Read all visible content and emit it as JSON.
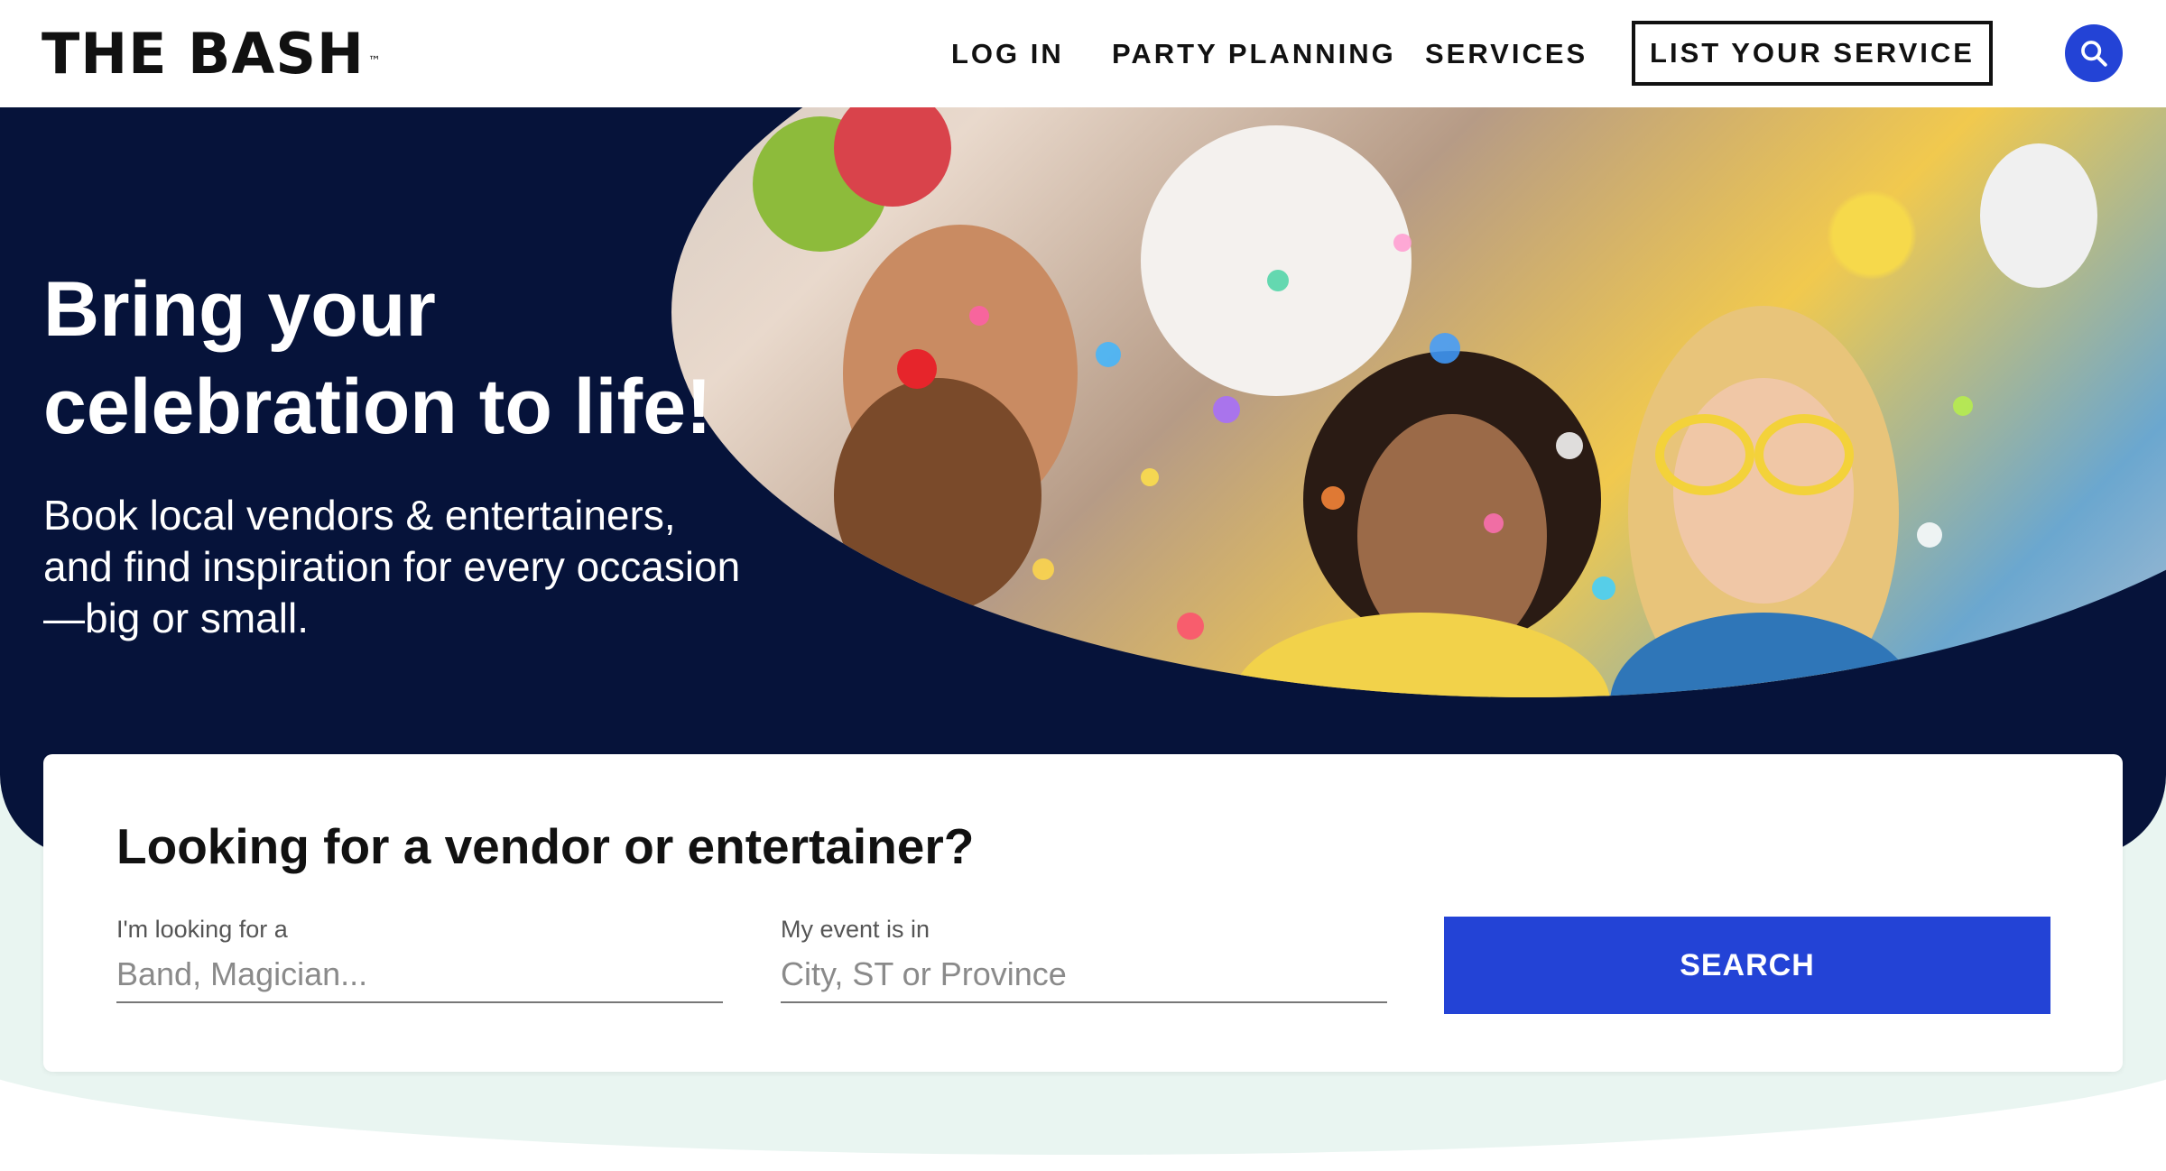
{
  "brand": {
    "logo_text": "THE BASH",
    "trademark": "™"
  },
  "nav": {
    "login": "LOG IN",
    "party_planning": "PARTY PLANNING",
    "services": "SERVICES",
    "list_service": "LIST YOUR SERVICE",
    "search_icon": "search-icon"
  },
  "hero": {
    "title_line1": "Bring your",
    "title_line2": "celebration to life!",
    "subtitle_line1": "Book local vendors & entertainers,",
    "subtitle_line2": "and find inspiration for every occasion",
    "subtitle_line3": "—big or small."
  },
  "search_card": {
    "title": "Looking for a vendor or entertainer?",
    "what_label": "I'm looking for a",
    "what_placeholder": "Band, Magician...",
    "where_label": "My event is in",
    "where_placeholder": "City, ST or Province",
    "button": "SEARCH"
  },
  "colors": {
    "navy": "#06133a",
    "accent_blue": "#2343d6",
    "mint": "#e9f5f1"
  }
}
